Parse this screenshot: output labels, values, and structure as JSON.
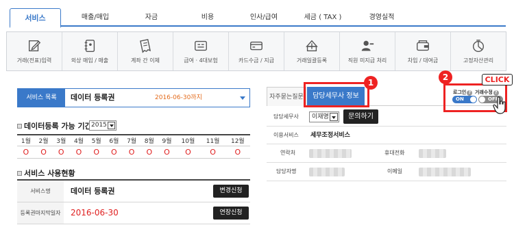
{
  "tabs": [
    "서비스",
    "매출/매입",
    "자금",
    "비용",
    "인사/급여",
    "세금 ( TAX )",
    "경영실적"
  ],
  "active_tab": "서비스",
  "menu": [
    {
      "label": "거래(전표)입력",
      "icon": "pencil-note-icon"
    },
    {
      "label": "외상 매입 / 매출",
      "icon": "ledger-book-icon"
    },
    {
      "label": "계좌 간 이체",
      "icon": "transfer-receipt-icon"
    },
    {
      "label": "급여 · 4대보험",
      "icon": "id-card-icon"
    },
    {
      "label": "카드수금 / 지급",
      "icon": "credit-card-icon"
    },
    {
      "label": "거래일괄등록",
      "icon": "bulk-upload-icon"
    },
    {
      "label": "직원 미지급 처리",
      "icon": "person-minus-icon"
    },
    {
      "label": "차입 / 대여금",
      "icon": "wallet-icon"
    },
    {
      "label": "고정자산관리",
      "icon": "asset-pie-icon"
    }
  ],
  "service_select": {
    "label": "서비스 목록",
    "name": "데이터 등록권",
    "expiry": "2016-06-30까지"
  },
  "available_period": {
    "title": "데이터등록 가능 기간",
    "year": "2015",
    "months": [
      "1월",
      "2월",
      "3월",
      "4월",
      "5월",
      "6월",
      "7월",
      "8월",
      "9월",
      "10월",
      "11월",
      "12월"
    ],
    "values": [
      "O",
      "O",
      "O",
      "O",
      "O",
      "O",
      "O",
      "O",
      "O",
      "O",
      "O",
      "O"
    ]
  },
  "usage": {
    "title": "서비스 사용현황",
    "rows": [
      {
        "key": "서비스명",
        "value": "데이터 등록권",
        "button": "변경신청"
      },
      {
        "key": "등록권마지막일자",
        "value": "2016-06-30",
        "button": "연장신청"
      }
    ]
  },
  "right_tabs": {
    "faq": "자주묻는질문",
    "tax_agent": "담당세무사 정보"
  },
  "tax_info": {
    "agent_label": "담당세무사",
    "agent_value": "이재명",
    "ask_button": "문의하기",
    "service_label": "이용서비스",
    "service_value": "세무조정서비스",
    "contact_label": "연락처",
    "mobile_label": "휴대전화",
    "staff_label": "담당자명",
    "email_label": "이메일"
  },
  "toggles": {
    "login_label": "로그인",
    "login_state": "ON",
    "trade_label": "거래수정",
    "trade_state": "OFF"
  },
  "annotations": {
    "badge1": "1",
    "badge2": "2",
    "click": "CLICK"
  },
  "colors": {
    "accent": "#3a79c9",
    "highlight": "#e22222",
    "date": "#e36b1b"
  }
}
